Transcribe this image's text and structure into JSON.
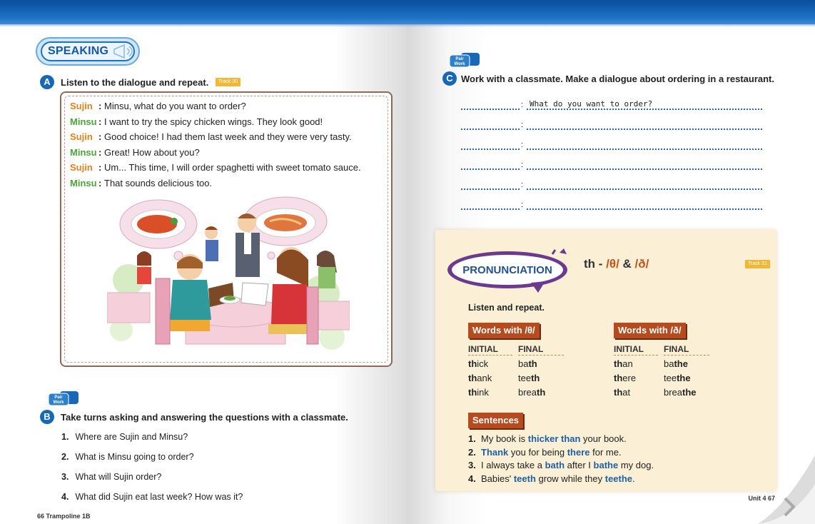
{
  "left_page": {
    "speaking_label": "SPEAKING",
    "section_a": {
      "letter": "A",
      "instruction": "Listen to the dialogue and repeat.",
      "track": "Track 30",
      "dialogue": [
        {
          "speaker": "Sujin",
          "line": "Minsu, what do you want to order?"
        },
        {
          "speaker": "Minsu",
          "line": "I want to try the spicy chicken wings. They look good!"
        },
        {
          "speaker": "Sujin",
          "line": "Good choice! I had them last week and they were very tasty."
        },
        {
          "speaker": "Minsu",
          "line": "Great! How about you?"
        },
        {
          "speaker": "Sujin",
          "line": "Um... This time, I will order spaghetti with sweet tomato sauce."
        },
        {
          "speaker": "Minsu",
          "line": "That sounds delicious too."
        }
      ]
    },
    "pair_work": [
      "Pair",
      "Work"
    ],
    "section_b": {
      "letter": "B",
      "instruction": "Take turns asking and answering the questions with a classmate.",
      "questions": [
        {
          "num": "1.",
          "text": "Where are Sujin and Minsu?"
        },
        {
          "num": "2.",
          "text": "What is Minsu going to order?"
        },
        {
          "num": "3.",
          "text": "What will Sujin order?"
        },
        {
          "num": "4.",
          "text": "What did Sujin eat last week? How was it?"
        }
      ]
    },
    "footer": "66 Trampoline 1B"
  },
  "right_page": {
    "section_c": {
      "letter": "C",
      "instruction": "Work with a classmate. Make a dialogue about ordering in a restaurant.",
      "first_line": "What do you want to order?"
    },
    "pronunciation": {
      "badge": "PRONUNCIATION",
      "title_prefix": "th - ",
      "sym1": "/θ/",
      "amp": " & ",
      "sym2": "/ð/",
      "track": "Track 31",
      "listen_repeat": "Listen and repeat.",
      "group1": {
        "heading": "Words with /θ/",
        "initial_label": "INITIAL",
        "final_label": "FINAL",
        "initial": [
          [
            "th",
            "ick"
          ],
          [
            "th",
            "ank"
          ],
          [
            "th",
            "ink"
          ]
        ],
        "final": [
          [
            "ba",
            "th",
            ""
          ],
          [
            "tee",
            "th",
            ""
          ],
          [
            "brea",
            "th",
            ""
          ]
        ]
      },
      "group2": {
        "heading": "Words with /ð/",
        "initial_label": "INITIAL",
        "final_label": "FINAL",
        "initial": [
          [
            "th",
            "an"
          ],
          [
            "th",
            "ere"
          ],
          [
            "th",
            "at"
          ]
        ],
        "final": [
          [
            "ba",
            "the",
            ""
          ],
          [
            "tee",
            "the",
            ""
          ],
          [
            "brea",
            "the",
            ""
          ]
        ]
      },
      "sentences_heading": "Sentences",
      "sentences": [
        {
          "num": "1.",
          "parts": [
            [
              "My book is ",
              false
            ],
            [
              "thicker than",
              true
            ],
            [
              " your book.",
              false
            ]
          ]
        },
        {
          "num": "2.",
          "parts": [
            [
              "Thank",
              true
            ],
            [
              " you for being ",
              false
            ],
            [
              "there",
              true
            ],
            [
              " for me.",
              false
            ]
          ]
        },
        {
          "num": "3.",
          "parts": [
            [
              "I always take a ",
              false
            ],
            [
              "bath",
              true
            ],
            [
              " after I ",
              false
            ],
            [
              "bathe",
              true
            ],
            [
              " my dog.",
              false
            ]
          ]
        },
        {
          "num": "4.",
          "parts": [
            [
              "Babies' ",
              false
            ],
            [
              "teeth",
              true
            ],
            [
              " grow while they ",
              false
            ],
            [
              "teethe",
              true
            ],
            [
              ".",
              false
            ]
          ]
        }
      ]
    },
    "pair_work": [
      "Pair",
      "Work"
    ],
    "footer": "Unit 4  67"
  },
  "colors": {
    "blue_band": "#1c6fc4",
    "sujin": "#e8801f",
    "minsu": "#4aa43a",
    "highlight": "#1f5fa3",
    "word_header": "#b54b1e",
    "pron_bg": "#fbf0d6"
  }
}
